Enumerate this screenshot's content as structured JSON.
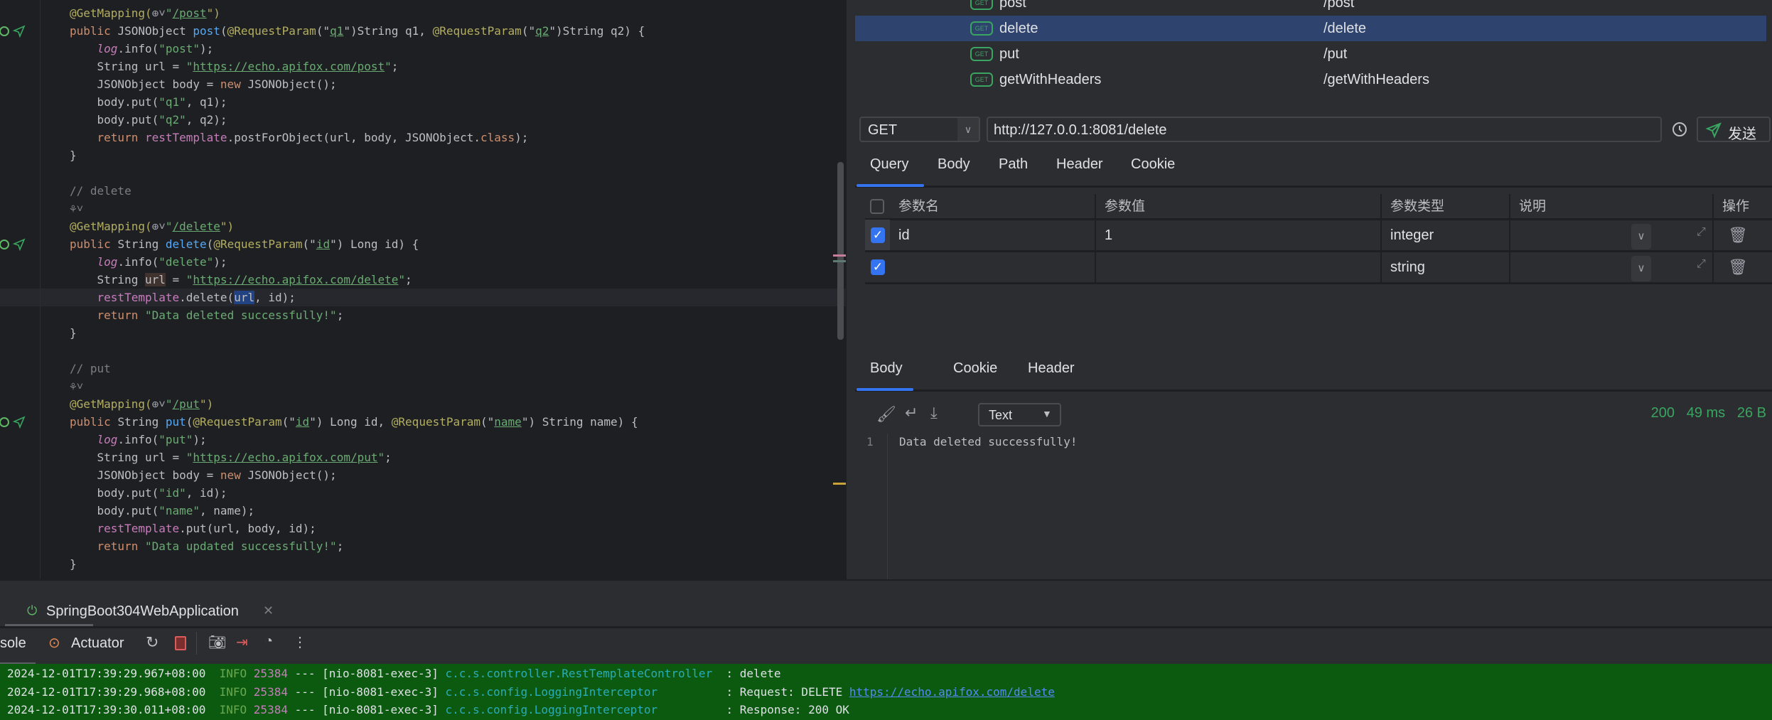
{
  "editor": {
    "lines": [
      {
        "t": [
          [
            "@GetMapping(",
            "a"
          ],
          [
            "@globe",
            ""
          ],
          [
            "\"",
            "s"
          ],
          [
            "/post",
            "su"
          ],
          [
            "\")",
            "a"
          ]
        ]
      },
      {
        "g": true,
        "t": [
          [
            "public ",
            "k"
          ],
          [
            "JSONObject ",
            "t"
          ],
          [
            "post",
            "m"
          ],
          [
            "(",
            "t"
          ],
          [
            "@RequestParam",
            "a"
          ],
          [
            "(\"",
            "t"
          ],
          [
            "q1",
            "su"
          ],
          [
            "\")",
            "t"
          ],
          [
            "String q1, ",
            "t"
          ],
          [
            "@RequestParam",
            "a"
          ],
          [
            "(\"",
            "t"
          ],
          [
            "q2",
            "su"
          ],
          [
            "\")",
            "t"
          ],
          [
            "String q2) {",
            "t"
          ]
        ]
      },
      {
        "t": [
          [
            "    ",
            "t"
          ],
          [
            "log",
            "fi"
          ],
          [
            ".info(",
            "t"
          ],
          [
            "\"post\"",
            "s"
          ],
          [
            ");",
            "t"
          ]
        ]
      },
      {
        "t": [
          [
            "    String url = ",
            "t"
          ],
          [
            "\"",
            "s"
          ],
          [
            "https://echo.apifox.com/post",
            "su"
          ],
          [
            "\"",
            "s"
          ],
          [
            ";",
            "t"
          ]
        ]
      },
      {
        "t": [
          [
            "    JSONObject body = ",
            "t"
          ],
          [
            "new ",
            "k"
          ],
          [
            "JSONObject();",
            "t"
          ]
        ]
      },
      {
        "t": [
          [
            "    body.put(",
            "t"
          ],
          [
            "\"q1\"",
            "s"
          ],
          [
            ", q1);",
            "t"
          ]
        ]
      },
      {
        "t": [
          [
            "    body.put(",
            "t"
          ],
          [
            "\"q2\"",
            "s"
          ],
          [
            ", q2);",
            "t"
          ]
        ]
      },
      {
        "t": [
          [
            "    ",
            "t"
          ],
          [
            "return ",
            "k"
          ],
          [
            "restTemplate",
            "f"
          ],
          [
            ".postForObject(url, body, JSONObject.",
            "t"
          ],
          [
            "class",
            "k"
          ],
          [
            ");",
            "t"
          ]
        ]
      },
      {
        "t": [
          [
            "}",
            "t"
          ]
        ]
      },
      {
        "t": []
      },
      {
        "t": [
          [
            "// delete",
            "c"
          ]
        ]
      },
      {
        "t": [
          [
            "@hint",
            ""
          ]
        ]
      },
      {
        "t": [
          [
            "@GetMapping(",
            "a"
          ],
          [
            "@globe",
            ""
          ],
          [
            "\"",
            "s"
          ],
          [
            "/delete",
            "su"
          ],
          [
            "\")",
            "a"
          ]
        ]
      },
      {
        "g": true,
        "t": [
          [
            "public ",
            "k"
          ],
          [
            "String ",
            "t"
          ],
          [
            "delete",
            "m"
          ],
          [
            "(",
            "t"
          ],
          [
            "@RequestParam",
            "a"
          ],
          [
            "(\"",
            "t"
          ],
          [
            "id",
            "su"
          ],
          [
            "\")",
            "t"
          ],
          [
            " Long id) {",
            "t"
          ]
        ]
      },
      {
        "t": [
          [
            "    ",
            "t"
          ],
          [
            "log",
            "fi"
          ],
          [
            ".info(",
            "t"
          ],
          [
            "\"delete\"",
            "s"
          ],
          [
            ");",
            "t"
          ]
        ]
      },
      {
        "t": [
          [
            "    String ",
            "t"
          ],
          [
            "url",
            "rd"
          ],
          [
            " = ",
            "t"
          ],
          [
            "\"",
            "s"
          ],
          [
            "https://echo.apifox.com/delete",
            "su"
          ],
          [
            "\"",
            "s"
          ],
          [
            ";",
            "t"
          ]
        ]
      },
      {
        "cur": true,
        "t": [
          [
            "    ",
            "t"
          ],
          [
            "restTemplate",
            "f"
          ],
          [
            ".delete(",
            "t"
          ],
          [
            "url",
            "sel"
          ],
          [
            ", id);",
            "t"
          ]
        ]
      },
      {
        "t": [
          [
            "    ",
            "t"
          ],
          [
            "return ",
            "k"
          ],
          [
            "\"Data deleted successfully!\"",
            "s"
          ],
          [
            ";",
            "t"
          ]
        ]
      },
      {
        "t": [
          [
            "}",
            "t"
          ]
        ]
      },
      {
        "t": []
      },
      {
        "t": [
          [
            "// put",
            "c"
          ]
        ]
      },
      {
        "t": [
          [
            "@hint",
            ""
          ]
        ]
      },
      {
        "t": [
          [
            "@GetMapping(",
            "a"
          ],
          [
            "@globe",
            ""
          ],
          [
            "\"",
            "s"
          ],
          [
            "/put",
            "su"
          ],
          [
            "\")",
            "a"
          ]
        ]
      },
      {
        "g": true,
        "t": [
          [
            "public ",
            "k"
          ],
          [
            "String ",
            "t"
          ],
          [
            "put",
            "m"
          ],
          [
            "(",
            "t"
          ],
          [
            "@RequestParam",
            "a"
          ],
          [
            "(\"",
            "t"
          ],
          [
            "id",
            "su"
          ],
          [
            "\")",
            "t"
          ],
          [
            " Long id, ",
            "t"
          ],
          [
            "@RequestParam",
            "a"
          ],
          [
            "(\"",
            "t"
          ],
          [
            "name",
            "su"
          ],
          [
            "\")",
            "t"
          ],
          [
            " String name) {",
            "t"
          ]
        ]
      },
      {
        "t": [
          [
            "    ",
            "t"
          ],
          [
            "log",
            "fi"
          ],
          [
            ".info(",
            "t"
          ],
          [
            "\"put\"",
            "s"
          ],
          [
            ");",
            "t"
          ]
        ]
      },
      {
        "t": [
          [
            "    String url = ",
            "t"
          ],
          [
            "\"",
            "s"
          ],
          [
            "https://echo.apifox.com/put",
            "su"
          ],
          [
            "\"",
            "s"
          ],
          [
            ";",
            "t"
          ]
        ]
      },
      {
        "t": [
          [
            "    JSONObject body = ",
            "t"
          ],
          [
            "new ",
            "k"
          ],
          [
            "JSONObject();",
            "t"
          ]
        ]
      },
      {
        "t": [
          [
            "    body.put(",
            "t"
          ],
          [
            "\"id\"",
            "s"
          ],
          [
            ", id);",
            "t"
          ]
        ]
      },
      {
        "t": [
          [
            "    body.put(",
            "t"
          ],
          [
            "\"name\"",
            "s"
          ],
          [
            ", name);",
            "t"
          ]
        ]
      },
      {
        "t": [
          [
            "    ",
            "t"
          ],
          [
            "restTemplate",
            "f"
          ],
          [
            ".put(url, body, id);",
            "t"
          ]
        ]
      },
      {
        "t": [
          [
            "    ",
            "t"
          ],
          [
            "return ",
            "k"
          ],
          [
            "\"Data updated successfully!\"",
            "s"
          ],
          [
            ";",
            "t"
          ]
        ]
      },
      {
        "t": [
          [
            "}",
            "t"
          ]
        ]
      }
    ]
  },
  "endpoints": [
    {
      "method": "GET",
      "name": "post",
      "path": "/post"
    },
    {
      "method": "GET",
      "name": "delete",
      "path": "/delete",
      "selected": true
    },
    {
      "method": "GET",
      "name": "put",
      "path": "/put"
    },
    {
      "method": "GET",
      "name": "getWithHeaders",
      "path": "/getWithHeaders"
    }
  ],
  "request": {
    "method": "GET",
    "url": "http://127.0.0.1:8081/delete",
    "send_label": "发送",
    "tabs": [
      "Query",
      "Body",
      "Path",
      "Header",
      "Cookie"
    ],
    "active_tab": "Query",
    "params_headers": [
      "参数名",
      "参数值",
      "参数类型",
      "说明",
      "操作"
    ],
    "params": [
      {
        "checked": true,
        "name": "id",
        "value": "1",
        "type": "integer",
        "desc": ""
      },
      {
        "checked": true,
        "name": "",
        "value": "",
        "type": "string",
        "desc": ""
      }
    ]
  },
  "response": {
    "tabs": [
      "Body",
      "Cookie",
      "Header"
    ],
    "active_tab": "Body",
    "format": "Text",
    "status": "200",
    "time": "49 ms",
    "size": "26 B",
    "line_no": "1",
    "body": "Data deleted successfully!"
  },
  "run": {
    "tab_label": "SpringBoot304WebApplication",
    "console_label": "sole",
    "actuator_label": "Actuator",
    "logs": [
      {
        "ts": "2024-12-01T17:39:29.967+08:00",
        "level": "INFO",
        "pid": "25384",
        "sep": "---",
        "thread": "[nio-8081-exec-3]",
        "logger": "c.c.s.controller.RestTemplateController ",
        "msg": ": delete",
        "link": ""
      },
      {
        "ts": "2024-12-01T17:39:29.968+08:00",
        "level": "INFO",
        "pid": "25384",
        "sep": "---",
        "thread": "[nio-8081-exec-3]",
        "logger": "c.c.s.config.LoggingInterceptor         ",
        "msg": ": Request: DELETE ",
        "link": "https://echo.apifox.com/delete"
      },
      {
        "ts": "2024-12-01T17:39:30.011+08:00",
        "level": "INFO",
        "pid": "25384",
        "sep": "---",
        "thread": "[nio-8081-exec-3]",
        "logger": "c.c.s.config.LoggingInterceptor         ",
        "msg": ": Response: 200 OK",
        "link": ""
      }
    ]
  },
  "colors": {
    "accent": "#3574f0",
    "selected_row": "#2e436e",
    "status_ok": "#3aa561",
    "console_bg": "#0b5a10"
  }
}
